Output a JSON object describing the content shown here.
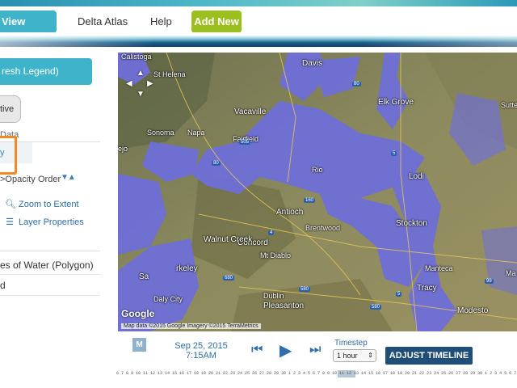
{
  "nav": {
    "view_layers": "View Layers",
    "delta_atlas": "Delta Atlas",
    "help": "Help",
    "add_new": "Add New"
  },
  "left_panel": {
    "refresh_legend": "resh Legend)",
    "active_button": "tive",
    "data_label": "Data",
    "selected_row": "y",
    "opacity_label": ">Opacity",
    "order_label": "Order",
    "zoom_to_extent": "Zoom to Extent",
    "layer_properties": "Layer Properties",
    "layer_water": "es of Water (Polygon)",
    "layer_d": "d"
  },
  "map": {
    "labels": {
      "calistoga": "Calistoga",
      "st_helena": "St Helena",
      "davis": "Davis",
      "elk_grove": "Elk Grove",
      "sutter": "Sutter",
      "vacaville": "Vacaville",
      "sonoma": "Sonoma",
      "napa": "Napa",
      "fairfield": "Fairfield",
      "vallejo": "ejo",
      "rio_vista": "Rio",
      "lodi": "Lodi",
      "concord": "Concord",
      "antioch": "Antioch",
      "brentwood": "Brentwood",
      "stockton": "Stockton",
      "walnut_creek": "Walnut Creek",
      "mt_diablo": "Mt Diablo",
      "berkeley": "rkeley",
      "manteca": "Manteca",
      "san": "Sa",
      "daly_city": "Daly City",
      "dublin": "Dublin",
      "pleasanton": "Pleasanton",
      "tracy": "Tracy",
      "modesto": "Modesto",
      "ma": "Ma"
    },
    "highways": [
      "80",
      "505",
      "80",
      "5",
      "4",
      "160",
      "680",
      "580",
      "580",
      "5",
      "99"
    ],
    "google": "Google",
    "attribution": "Map data ©2015 Google Imagery ©2015 TerraMetrics"
  },
  "playback": {
    "m_button": "M",
    "date": "Sep 25, 2015",
    "time": "7:15AM",
    "timestep_label": "Timestep",
    "timestep_value": "1 hour",
    "adjust_timeline": "ADJUST TIMELINE",
    "hours": "6 7 8 9 10 11 12 13 14 15 16 17 18 19 20 21 22 23 24 25 26 27 28 29 30 1 2 3 4 5 6 7 8 9 10 11 12 13 14 15 16 17 18 19 20 21 22 23 24 25 26 27 28 29 30 1 2 3 4 5 6 7 8 9 10 11 12 13 14 15 16 17 18 19 20 21 22 23 24 25 26 27"
  },
  "colors": {
    "accent_teal": "#3fb3c9",
    "accent_green": "#9bbf1e",
    "water_overlay": "#6f6fd8",
    "highlight_orange": "#f08a24",
    "dark_button": "#1f4f78"
  }
}
